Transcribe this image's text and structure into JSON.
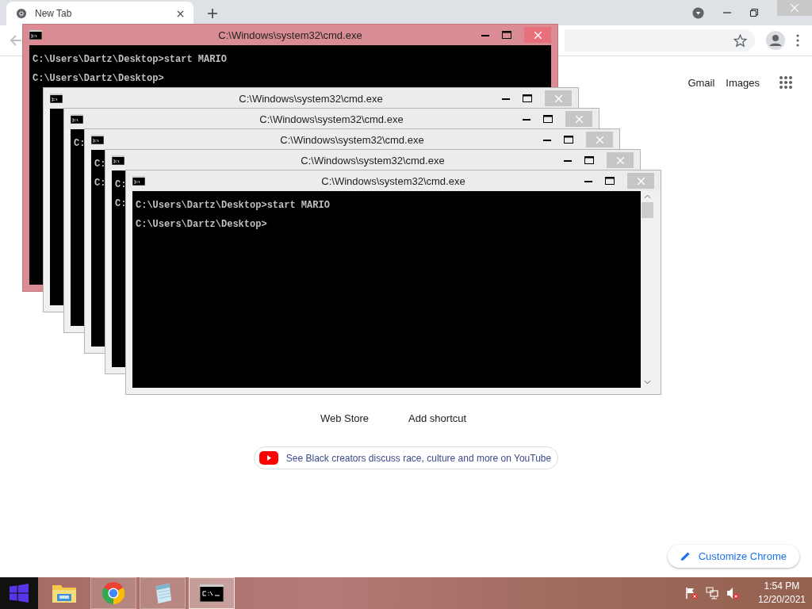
{
  "browser": {
    "tab": {
      "title": "New Tab",
      "selected": true
    },
    "header_links": [
      "Gmail",
      "Images"
    ],
    "shortcuts": [
      "Web Store",
      "Add shortcut"
    ],
    "promo": "See Black creators discuss race, culture and more on YouTube",
    "customize": "Customize Chrome"
  },
  "cmd_windows": [
    {
      "title": "C:\\Windows\\system32\\cmd.exe",
      "active": true,
      "lines": [
        "C:\\Users\\Dartz\\Desktop>start MARIO",
        "C:\\Users\\Dartz\\Desktop>"
      ]
    },
    {
      "title": "C:\\Windows\\system32\\cmd.exe",
      "active": false
    },
    {
      "title": "C:\\Windows\\system32\\cmd.exe",
      "active": false,
      "lines": [
        "C:"
      ]
    },
    {
      "title": "C:\\Windows\\system32\\cmd.exe",
      "active": false,
      "lines": [
        "C:",
        "C:"
      ]
    },
    {
      "title": "C:\\Windows\\system32\\cmd.exe",
      "active": false,
      "lines": [
        "C:",
        "C:"
      ]
    },
    {
      "title": "C:\\Windows\\system32\\cmd.exe",
      "active": false,
      "lines": [
        "C:\\Users\\Dartz\\Desktop>start MARIO",
        "C:\\Users\\Dartz\\Desktop>"
      ]
    }
  ],
  "taskbar": {
    "apps": [
      {
        "kind": "explorer",
        "running": false,
        "selected": false
      },
      {
        "kind": "chrome",
        "running": true,
        "selected": false
      },
      {
        "kind": "notepad",
        "running": true,
        "selected": false
      },
      {
        "kind": "cmd",
        "running": true,
        "selected": true
      }
    ],
    "clock": {
      "time": "1:54 PM",
      "date": "12/20/2021"
    }
  }
}
